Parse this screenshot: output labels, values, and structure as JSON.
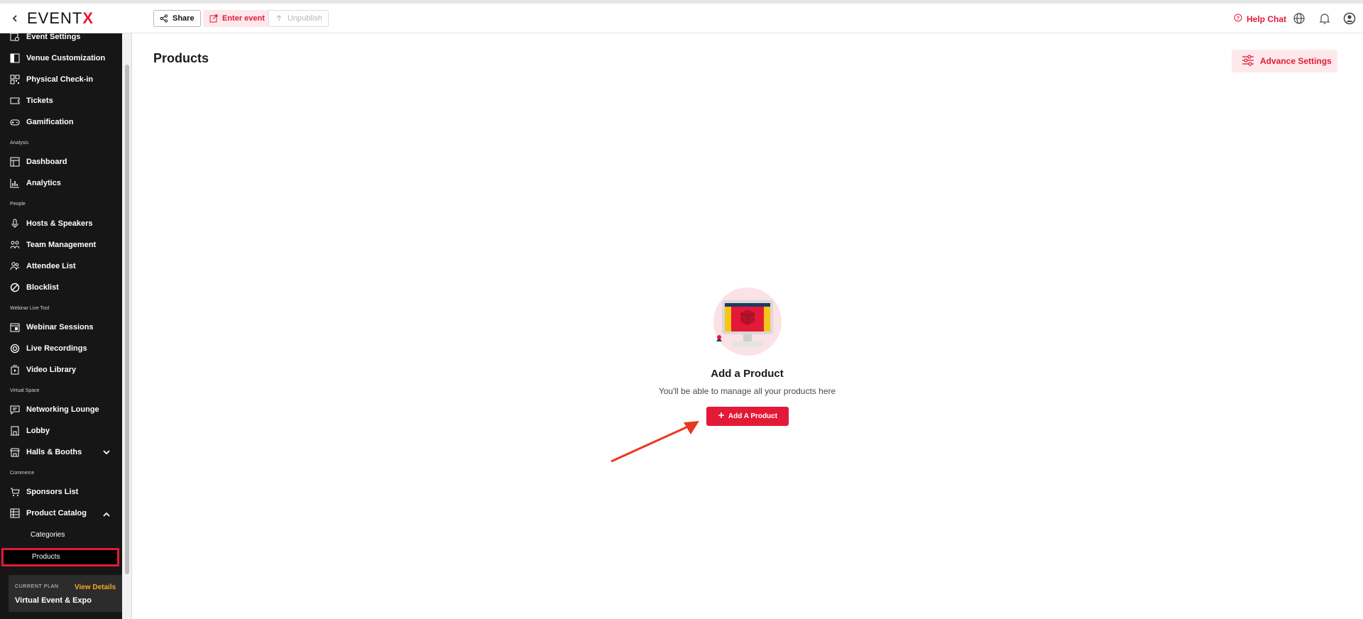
{
  "topbar": {
    "logo_main": "EVENT",
    "logo_accent": "X",
    "share_label": "Share",
    "enter_label": "Enter event",
    "unpublish_label": "Unpublish",
    "help_label": "Help Chat"
  },
  "sidebar": {
    "items_top": [
      {
        "label": "Event Settings",
        "icon": "settings-icon"
      },
      {
        "label": "Venue Customization",
        "icon": "layout-icon"
      },
      {
        "label": "Physical Check-in",
        "icon": "qr-icon"
      },
      {
        "label": "Tickets",
        "icon": "ticket-icon"
      },
      {
        "label": "Gamification",
        "icon": "gamepad-icon"
      }
    ],
    "section_analysis": "Analysis",
    "items_analysis": [
      {
        "label": "Dashboard",
        "icon": "dashboard-icon"
      },
      {
        "label": "Analytics",
        "icon": "bar-chart-icon"
      }
    ],
    "section_people": "People",
    "items_people": [
      {
        "label": "Hosts & Speakers",
        "icon": "microphone-icon"
      },
      {
        "label": "Team Management",
        "icon": "team-icon"
      },
      {
        "label": "Attendee List",
        "icon": "people-icon"
      },
      {
        "label": "Blocklist",
        "icon": "block-icon"
      }
    ],
    "section_webinar": "Webinar Live Tool",
    "items_webinar": [
      {
        "label": "Webinar Sessions",
        "icon": "calendar-icon"
      },
      {
        "label": "Live Recordings",
        "icon": "record-icon"
      },
      {
        "label": "Video Library",
        "icon": "video-library-icon"
      }
    ],
    "section_virtual": "Virtual Space",
    "items_virtual": [
      {
        "label": "Networking Lounge",
        "icon": "chat-icon"
      },
      {
        "label": "Lobby",
        "icon": "lobby-icon"
      },
      {
        "label": "Halls & Booths",
        "icon": "booth-icon"
      }
    ],
    "section_commerce": "Commerce",
    "items_commerce": [
      {
        "label": "Sponsors List",
        "icon": "cart-icon"
      },
      {
        "label": "Product Catalog",
        "icon": "catalog-icon"
      }
    ],
    "sub_items": [
      "Categories",
      "Products"
    ],
    "plan_caption": "CURRENT PLAN",
    "plan_view": "View Details",
    "plan_name": "Virtual Event & Expo"
  },
  "main": {
    "title": "Products",
    "advance_label": "Advance Settings",
    "empty_title": "Add a Product",
    "empty_subtitle": "You'll be able to manage all your products here",
    "add_button": "Add A Product"
  },
  "colors": {
    "accent": "#e31937",
    "accent_soft": "#fde9ec",
    "sidebar_bg": "#161616",
    "plan_highlight": "#f5a623"
  }
}
